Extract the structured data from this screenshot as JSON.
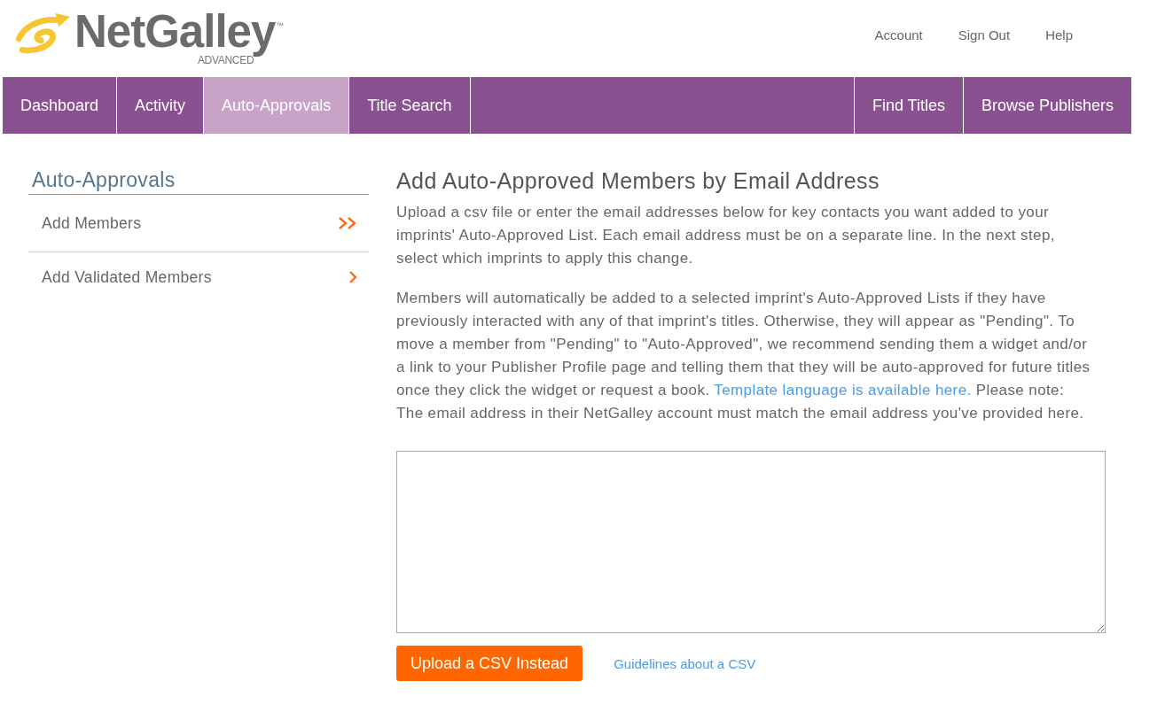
{
  "header": {
    "logo": {
      "name": "NetGalley",
      "trademark": "™",
      "edition": "ADVANCED"
    },
    "links": [
      "Account",
      "Sign Out",
      "Help"
    ]
  },
  "nav": {
    "main_tabs": [
      {
        "label": "Dashboard",
        "selected": false
      },
      {
        "label": "Activity",
        "selected": false
      },
      {
        "label": "Auto-Approvals",
        "selected": true
      },
      {
        "label": "Title Search",
        "selected": false
      }
    ],
    "side_tabs": [
      {
        "label": "Find Titles",
        "selected": false
      },
      {
        "label": "Browse Publishers",
        "selected": false
      }
    ]
  },
  "sidebar": {
    "title": "Auto-Approvals",
    "items": [
      {
        "label": "Add Members",
        "selected": true
      },
      {
        "label": "Add Validated Members",
        "selected": false
      }
    ]
  },
  "main": {
    "title": "Add Auto-Approved Members by Email Address",
    "paragraphs": [
      [
        {
          "kind": "text",
          "text": "Upload a csv file or enter the email addresses below for key contacts you want added to your imprints' Auto-Approved List. Each email address must be on a separate line. In the next step, select which imprints to apply this change."
        }
      ],
      [
        {
          "kind": "text",
          "text": "Members will automatically be added to a selected imprint's Auto-Approved Lists if they have previously interacted with any of that imprint's titles. Otherwise, they will appear as \"Pending\". To move a member from \"Pending\" to \"Auto-Approved\", we recommend sending them a widget and/or a link to your Publisher Profile page and telling them that they will be auto-approved for future titles once they click the widget or request a book. "
        },
        {
          "kind": "link",
          "text": "Template language is available here."
        },
        {
          "kind": "text",
          "text": " Please note: The email address in their NetGalley account must match the email address you've provided here."
        }
      ]
    ],
    "upload_button": "Upload a CSV Instead",
    "guidelines_link": "Guidelines about a CSV"
  }
}
